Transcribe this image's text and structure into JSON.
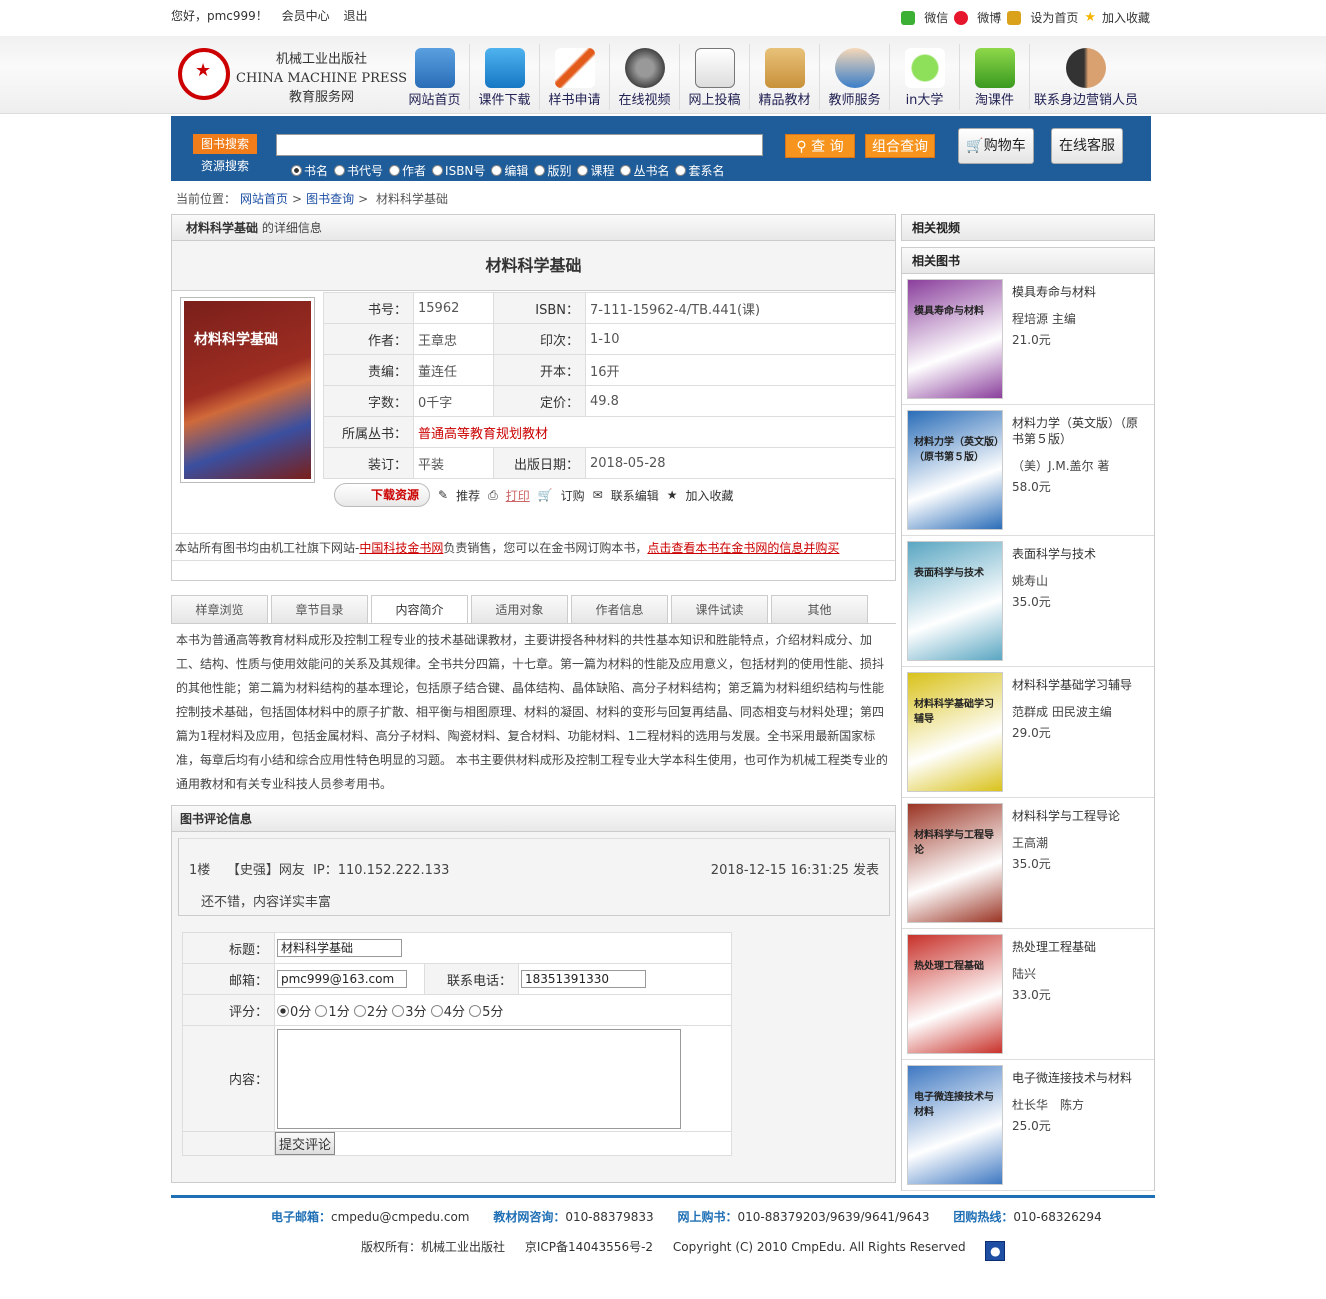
{
  "topbar": {
    "greeting": "您好，pmc999！",
    "member": "会员中心",
    "logout": "退出",
    "wechat": "微信",
    "weibo": "微博",
    "set_home": "设为首页",
    "favorite": "加入收藏"
  },
  "logo": {
    "line1": "机械工业出版社",
    "line2": "CHINA MACHINE PRESS",
    "line3": "教育服务网"
  },
  "nav": [
    "网站首页",
    "课件下载",
    "样书申请",
    "在线视频",
    "网上投稿",
    "精品教材",
    "教师服务",
    "in大学",
    "淘课件",
    "联系身边营销人员"
  ],
  "search": {
    "tab_books": "图书搜索",
    "tab_resources": "资源搜索",
    "options": [
      "书名",
      "书代号",
      "作者",
      "ISBN号",
      "编辑",
      "版别",
      "课程",
      "丛书名",
      "套系名"
    ],
    "btn_search": "查 询",
    "btn_combo": "组合查询",
    "btn_cart": "购物车",
    "btn_service": "在线客服"
  },
  "breadcrumb": {
    "prefix": "当前位置：",
    "home": "网站首页",
    "query": "图书查询",
    "current": "材料科学基础",
    "sep": ">"
  },
  "book": {
    "head_title": "材料科学基础",
    "head_suffix": " 的详细信息",
    "title": "材料科学基础",
    "cover_text": "材料科学基础",
    "labels": {
      "code": "书号：",
      "isbn": "ISBN：",
      "author": "作者：",
      "print": "印次：",
      "editor": "责编：",
      "format": "开本：",
      "words": "字数：",
      "price": "定价：",
      "series": "所属丛书：",
      "binding": "装订：",
      "pubdate": "出版日期："
    },
    "code": "15962",
    "isbn": "7-111-15962-4/TB.441(课)",
    "author": "王章忠",
    "print": "1-10",
    "editor": "董连任",
    "format": "16开",
    "words": "0千字",
    "price": "49.8",
    "series": "普通高等教育规划教材",
    "binding": "平装",
    "pubdate": "2018-05-28",
    "actions": {
      "download": "下载资源",
      "recommend": "推荐",
      "print": "打印",
      "order": "订购",
      "contact": "联系编辑",
      "collect": "加入收藏"
    },
    "notice1": "本站所有图书均由机工社旗下网站-",
    "notice_link1": "中国科技金书网",
    "notice2": "负责销售，您可以在金书网订购本书，",
    "notice_link2": "点击查看本书在金书网的信息并购买"
  },
  "tabs": [
    "样章浏览",
    "章节目录",
    "内容简介",
    "适用对象",
    "作者信息",
    "课件试读",
    "其他"
  ],
  "description": "本书为普通高等教育材料成形及控制工程专业的技术基础课教材，主要讲授各种材料的共性基本知识和胜能特点，介绍材料成分、加工、结构、性质与使用效能问的关系及其规律。全书共分四篇，十七章。第一篇为材料的性能及应用意义，包括材判的使用性能、损抖的其他性能；第二篇为材料结构的基本理论，包括原子结合键、晶体结构、晶体缺陷、高分子材料结构；第乏篇为材料组织结构与性能控制技术基础，包括固体材料中的原子扩散、相平衡与相图原理、材料的凝固、材料的变形与回复再结晶、同态相变与材料处理；第四篇为1程材料及应用，包括金属材料、高分子材料、陶瓷材料、复合材料、功能材料、1二程材料的选用与发展。全书采用最新国家标准，每章后均有小结和综合应用性特色明显的习题。 本书主要供材料成形及控制工程专业大学本科生使用，也可作为机械工程类专业的通用教材和有关专业科技人员参考用书。",
  "review": {
    "head": "图书评论信息",
    "floor": "1楼",
    "user": "【史强】网友",
    "ip": "IP：110.152.222.133",
    "date": "2018-12-15 16:31:25 发表",
    "content": "还不错，内容详实丰富",
    "form": {
      "title_label": "标题：",
      "title_value": "材料科学基础",
      "email_label": "邮箱：",
      "email_value": "pmc999@163.com",
      "phone_label": "联系电话：",
      "phone_value": "18351391330",
      "rating_label": "评分：",
      "ratings": [
        "0分",
        "1分",
        "2分",
        "3分",
        "4分",
        "5分"
      ],
      "content_label": "内容：",
      "submit": "提交评论"
    }
  },
  "sidebar": {
    "videos_head": "相关视频",
    "books_head": "相关图书",
    "books": [
      {
        "title": "模具寿命与材料",
        "author": "程培源 主编",
        "price": "21.0元",
        "color": "#8a3f9c"
      },
      {
        "title": "材料力学（英文版）（原书第５版）",
        "author": "（美）J.M.盖尔 著",
        "price": "58.0元",
        "color": "#2a6db8"
      },
      {
        "title": "表面科学与技术",
        "author": "姚寿山",
        "price": "35.0元",
        "color": "#5aa6c2"
      },
      {
        "title": "材料科学基础学习辅导",
        "author": "范群成 田民波主编",
        "price": "29.0元",
        "color": "#d9c21a"
      },
      {
        "title": "材料科学与工程导论",
        "author": "王高潮",
        "price": "35.0元",
        "color": "#9a3424"
      },
      {
        "title": "热处理工程基础",
        "author": "陆兴",
        "price": "33.0元",
        "color": "#c8312a"
      },
      {
        "title": "电子微连接技术与材料",
        "author": "杜长华　陈方",
        "price": "25.0元",
        "color": "#3e78c2"
      }
    ]
  },
  "footer": {
    "email_label": "电子邮箱：",
    "email": "cmpedu@cmpedu.com",
    "consult_label": "教材网咨询：",
    "consult": "010-88379833",
    "buy_label": "网上购书：",
    "buy": "010-88379203/9639/9641/9643",
    "group_label": "团购热线：",
    "group": "010-68326294",
    "copyright": "版权所有：机械工业出版社",
    "icp": "京ICP备14043556号-2",
    "rights": "Copyright (C) 2010 CmpEdu. All Rights Reserved"
  }
}
